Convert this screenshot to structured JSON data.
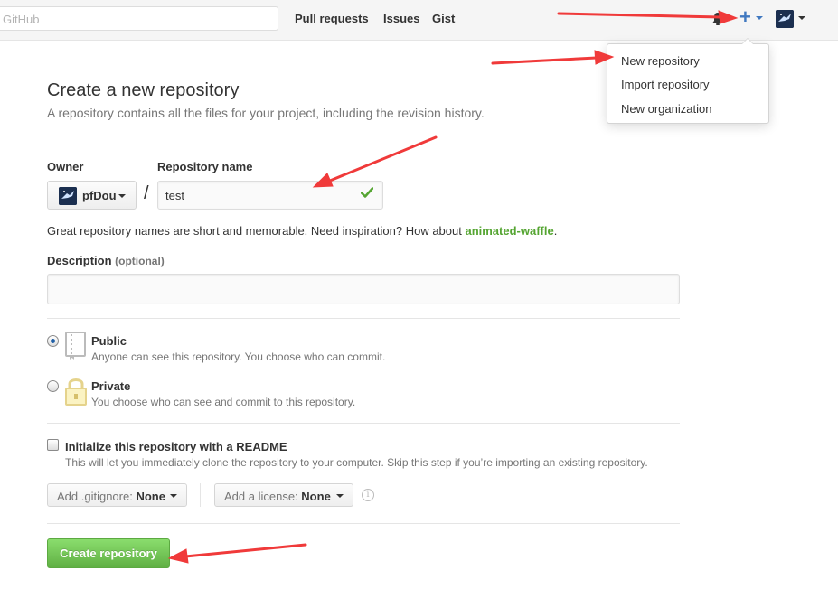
{
  "header": {
    "search_placeholder": "GitHub",
    "nav": [
      "Pull requests",
      "Issues",
      "Gist"
    ],
    "plus_glyph": "+",
    "icons": [
      "bell-icon",
      "plus-icon",
      "avatar"
    ]
  },
  "dropdown": {
    "items": [
      "New repository",
      "Import repository",
      "New organization"
    ]
  },
  "page": {
    "title": "Create a new repository",
    "subtitle": "A repository contains all the files for your project, including the revision history."
  },
  "form": {
    "owner_label": "Owner",
    "owner_value": "pfDou",
    "slash": "/",
    "repo_label": "Repository name",
    "repo_value": "test",
    "hint_prefix": "Great repository names are short and memorable. Need inspiration? How about ",
    "hint_suggestion": "animated-waffle",
    "hint_suffix": ".",
    "description_label": "Description",
    "description_optional": "(optional)",
    "description_value": ""
  },
  "visibility": {
    "selected": "public",
    "public_title": "Public",
    "public_desc": "Anyone can see this repository. You choose who can commit.",
    "private_title": "Private",
    "private_desc": "You choose who can see and commit to this repository."
  },
  "init": {
    "checked": false,
    "title": "Initialize this repository with a README",
    "desc": "This will let you immediately clone the repository to your computer. Skip this step if you’re importing an existing repository."
  },
  "selects": {
    "gitignore_label": "Add .gitignore:",
    "gitignore_value": "None",
    "license_label": "Add a license:",
    "license_value": "None"
  },
  "submit_label": "Create repository",
  "colors": {
    "accent_blue": "#4078c0",
    "success_green": "#55a532",
    "button_green": "#60b044",
    "annotation_red": "#f03a3a"
  }
}
